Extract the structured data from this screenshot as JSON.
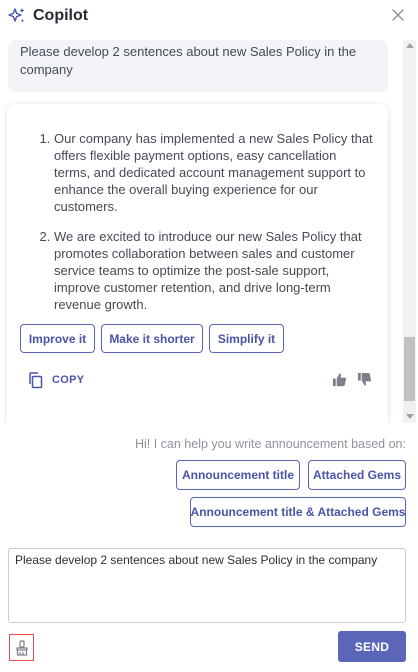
{
  "header": {
    "title": "Copilot"
  },
  "chat": {
    "user_message": "Please develop 2 sentences about new Sales Policy in the company",
    "reply_items": [
      "Our company has implemented a new Sales Policy that offers flexible payment options, easy cancellation terms, and dedicated account management support to enhance the overall buying experience for our customers.",
      "We are excited to introduce our new Sales Policy that promotes collaboration between sales and customer service teams to optimize the post-sale support, improve customer retention, and drive long-term revenue growth."
    ],
    "actions": {
      "improve": "Improve it",
      "shorter": "Make it shorter",
      "simplify": "Simplify it",
      "copy": "COPY"
    }
  },
  "assistant_hint": "Hi! I can help you write announcement based on:",
  "suggestions": {
    "title": "Announcement title",
    "gems": "Attached Gems",
    "both": "Announcement title & Attached Gems"
  },
  "composer": {
    "value": "Please develop 2 sentences about new Sales Policy in the company",
    "send_label": "SEND"
  },
  "icons": {
    "header": "sparkle-icon",
    "close": "close-icon",
    "copy": "copy-icon",
    "like": "thumbs-up-icon",
    "dislike": "thumbs-down-icon",
    "clear": "brush-icon"
  },
  "colors": {
    "accent": "#5b66b8",
    "accent_text": "#4a54a8",
    "bubble": "#f2f4f7",
    "hint": "#8f939c",
    "danger_outline": "#e05050"
  }
}
